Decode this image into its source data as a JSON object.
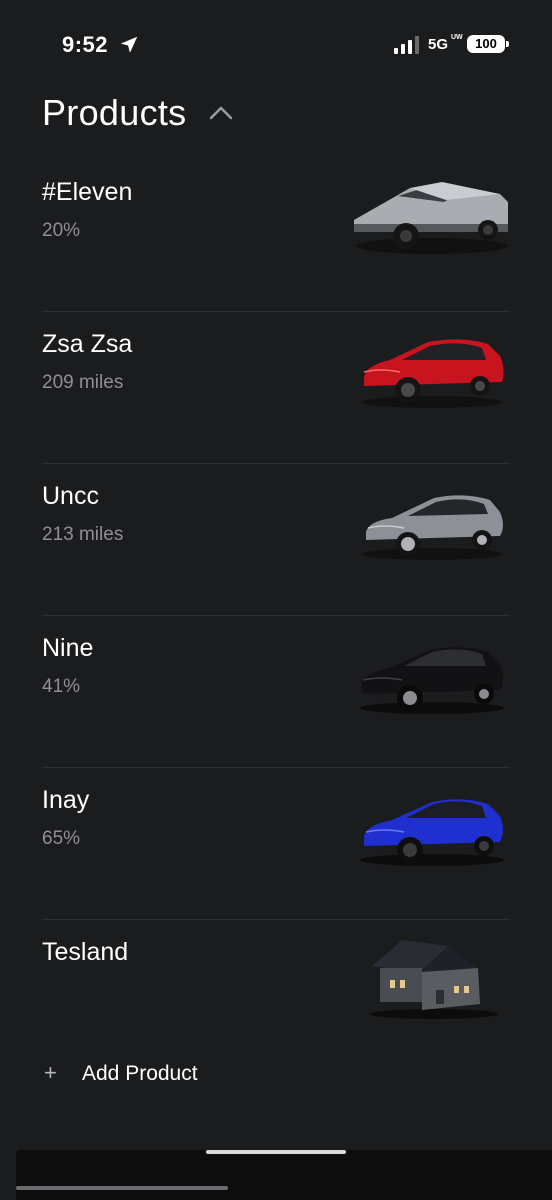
{
  "status_bar": {
    "time": "9:52",
    "network": "5G",
    "network_sub": "UW",
    "battery": "100"
  },
  "header": {
    "title": "Products"
  },
  "products": [
    {
      "name": "#Eleven",
      "status": "20%",
      "image": "cybertruck-image",
      "color": "#b9bcc0"
    },
    {
      "name": "Zsa Zsa",
      "status": "209 miles",
      "image": "model-x-red-image",
      "color": "#c8141e"
    },
    {
      "name": "Uncc",
      "status": "213 miles",
      "image": "model-s-silver-image",
      "color": "#8d9096"
    },
    {
      "name": "Nine",
      "status": "41%",
      "image": "model-y-black-image",
      "color": "#1a1a1c"
    },
    {
      "name": "Inay",
      "status": "65%",
      "image": "model-3-blue-image",
      "color": "#1f2fd0"
    },
    {
      "name": "Tesland",
      "status": "",
      "image": "solar-house-image",
      "color": "#3c3e44"
    }
  ],
  "add_product": {
    "icon": "plus-icon",
    "label": "Add Product"
  },
  "theme": {
    "background": "#1b1c1e",
    "text": "#ffffff",
    "muted": "#8f9094",
    "divider": "#2e2f32"
  }
}
